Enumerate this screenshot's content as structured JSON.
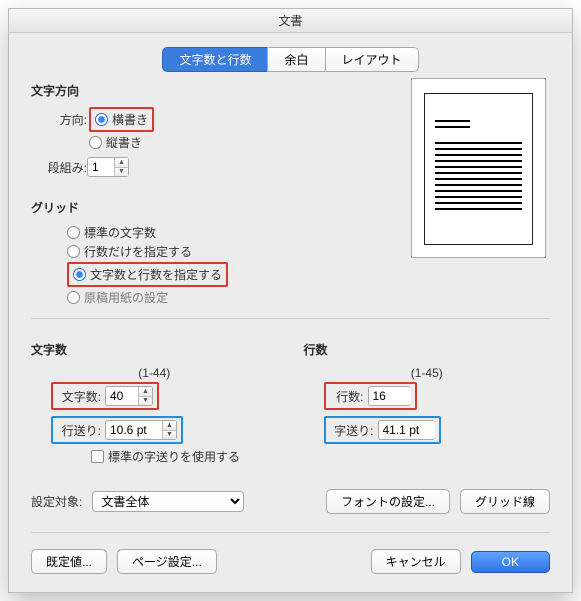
{
  "window": {
    "title": "文書"
  },
  "tabs": {
    "items": [
      "文字数と行数",
      "余白",
      "レイアウト"
    ],
    "active": 0
  },
  "direction": {
    "title": "文字方向",
    "label": "方向:",
    "options": [
      "横書き",
      "縦書き"
    ],
    "selected": 0,
    "columns_label": "段組み:",
    "columns_value": "1"
  },
  "grid": {
    "title": "グリッド",
    "options": [
      "標準の文字数",
      "行数だけを指定する",
      "文字数と行数を指定する",
      "原稿用紙の設定"
    ],
    "selected": 2
  },
  "char": {
    "title": "文字数",
    "range": "(1-44)",
    "count_label": "文字数:",
    "count_value": "40",
    "pitch_label": "行送り:",
    "pitch_value": "10.6 pt",
    "use_default_label": "標準の字送りを使用する"
  },
  "line": {
    "title": "行数",
    "range": "(1-45)",
    "count_label": "行数:",
    "count_value": "16",
    "pitch_label": "字送り:",
    "pitch_value": "41.1 pt"
  },
  "apply": {
    "label": "設定対象:",
    "value": "文書全体",
    "font_btn": "フォントの設定...",
    "grid_btn": "グリッド線"
  },
  "footer": {
    "defaults": "既定値...",
    "page_setup": "ページ設定...",
    "cancel": "キャンセル",
    "ok": "OK"
  }
}
